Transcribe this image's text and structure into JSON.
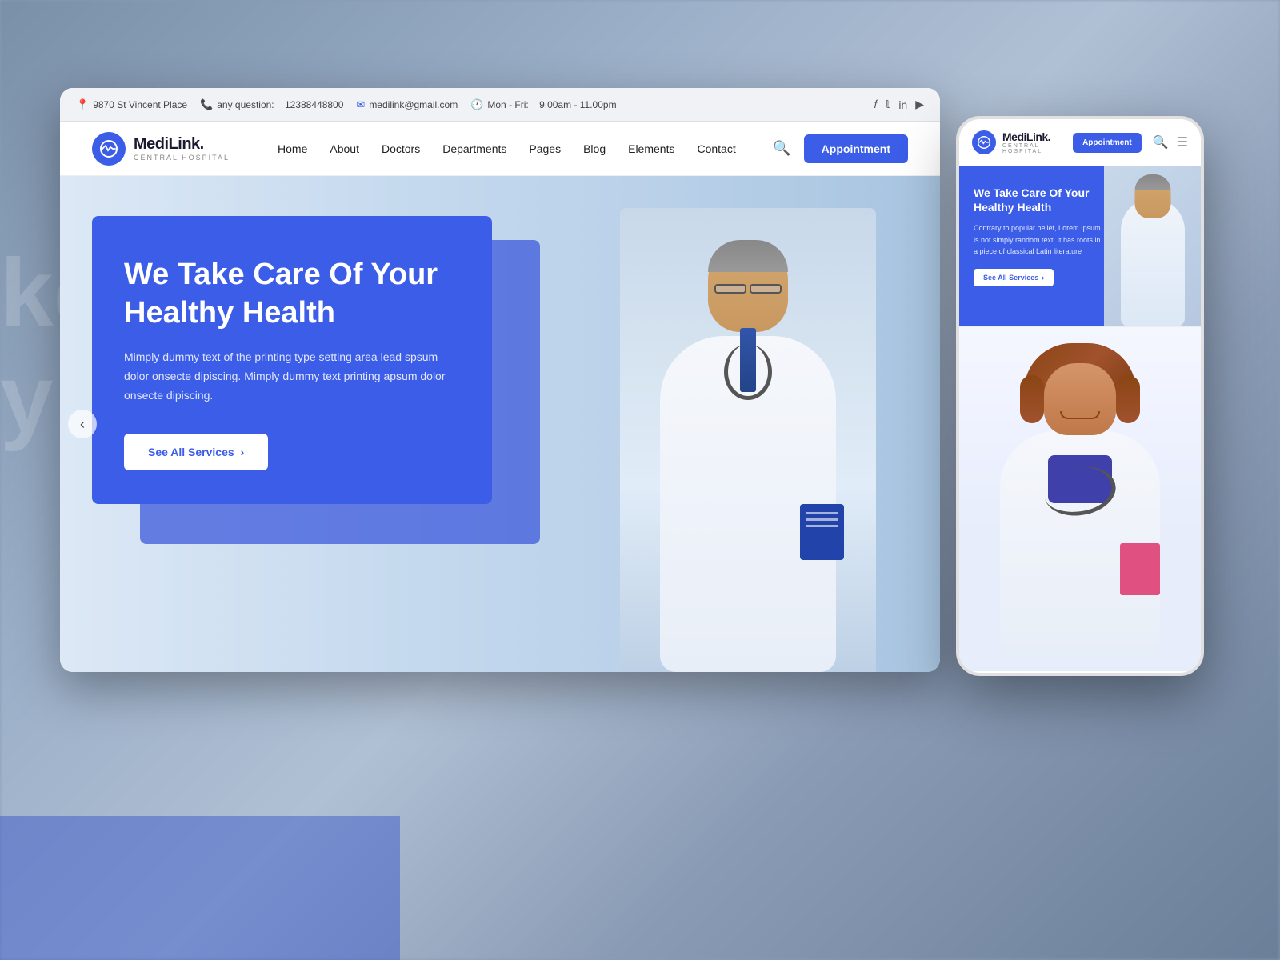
{
  "background": {
    "text_left_line1": "ke",
    "text_left_line2": "y h"
  },
  "topbar": {
    "address": "9870 St Vincent Place",
    "phone_label": "any question:",
    "phone_number": "12388448800",
    "email": "medilink@gmail.com",
    "hours_label": "Mon - Fri:",
    "hours": "9.00am - 11.00pm"
  },
  "navbar": {
    "logo_name": "MediLink.",
    "logo_sub": "CENTRAL HOSPITAL",
    "logo_icon": "♥",
    "links": [
      "Home",
      "About",
      "Doctors",
      "Departments",
      "Pages",
      "Blog",
      "Elements",
      "Contact"
    ],
    "appointment_btn": "Appointment"
  },
  "hero": {
    "title": "We Take Care Of Your Healthy Health",
    "description": "Mimply dummy text of the printing type setting area lead spsum dolor onsecte dipiscing. Mimply dummy text printing apsum dolor onsecte dipiscing.",
    "cta_btn": "See All Services",
    "cta_arrow": "›"
  },
  "phone_mockup": {
    "logo_name": "MediLink.",
    "logo_sub": "CENTRAL HOSPITAL",
    "logo_icon": "♥",
    "appointment_btn": "Appointment",
    "hero_title": "We Take Care Of Your Healthy Health",
    "hero_description": "Contrary to popular belief, Lorem Ipsum is not simply random text. It has roots in a piece of classical Latin literature",
    "hero_cta": "See All Services",
    "hero_arrow": "›"
  }
}
